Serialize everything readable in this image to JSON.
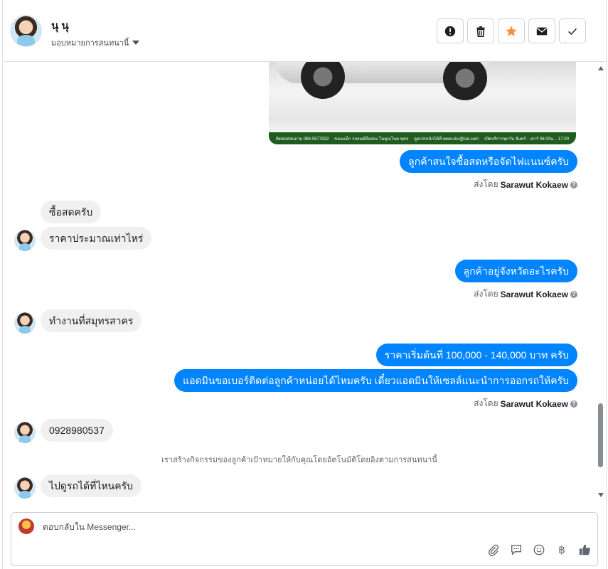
{
  "header": {
    "contact_name": "นุ นุ",
    "assign_label": "มอบหมายการสนทนานี้",
    "actions": [
      {
        "name": "mark-spam-button",
        "icon": "alert-circle-icon"
      },
      {
        "name": "delete-button",
        "icon": "trash-icon"
      },
      {
        "name": "star-button",
        "icon": "star-icon"
      },
      {
        "name": "mark-unread-button",
        "icon": "envelope-icon"
      },
      {
        "name": "mark-done-button",
        "icon": "check-icon"
      }
    ]
  },
  "attachment": {
    "strip_texts": [
      "ติดต่อสอบถาม 088-5577932",
      "ขอนแม็ก รถยนต์มือสอง โนคุณโนค ขุดจ",
      "ดูสเปรถนักได้ที่ www.ckc@car.com",
      "เปิดบริการทุกวัน จันทร์ - เสาร์ 06:00น. - 17:00"
    ]
  },
  "messages": [
    {
      "id": "m1",
      "dir": "out",
      "text": "ลูกค้าสนใจซื้อสดหรือจัดไฟแนนซ์ครับ"
    },
    {
      "id": "m2",
      "dir": "in",
      "text": "ซื้อสดครับ"
    },
    {
      "id": "m3",
      "dir": "in",
      "text": "ราคาประมาณเท่าไหร่"
    },
    {
      "id": "m4",
      "dir": "out",
      "text": "ลูกค้าอยู่จังหวัดอะไรครับ"
    },
    {
      "id": "m5",
      "dir": "in",
      "text": "ทำงานที่สมุทรสาคร"
    },
    {
      "id": "m6",
      "dir": "out",
      "text": "ราคาเริ่มต้นที่ 100,000 - 140,000 บาท ครับ"
    },
    {
      "id": "m7",
      "dir": "out",
      "text": "แอดมินขอเบอร์ติดต่อลูกค้าหน่อยได้ไหมครับ เดี๋ยวแอดมินให้เซลล์แนะนำการออกรถให้ครับ"
    },
    {
      "id": "m8",
      "dir": "in",
      "text": "0928980537"
    },
    {
      "id": "m9",
      "dir": "in",
      "text": "ไปดูรถได้ที่ไหนครับ"
    }
  ],
  "sent_by": {
    "prefix": "ส่งโดย",
    "agent": "Sarawut Kokaew"
  },
  "system_note": "เราสร้างกิจกรรมของลูกค้าเป้าหมายให้กับคุณโดยอัตโนมัติโดยอิงตามการสนทนานี้",
  "composer": {
    "placeholder": "ตอบกลับใน Messenger...",
    "tools": [
      "paperclip-icon",
      "chat-bubble-icon",
      "emoji-icon",
      "baht-icon",
      "thumbs-up-icon"
    ],
    "baht_symbol": "฿"
  },
  "colors": {
    "outgoing": "#0084ff",
    "incoming": "#f0f0f0",
    "star": "#f7923b"
  }
}
